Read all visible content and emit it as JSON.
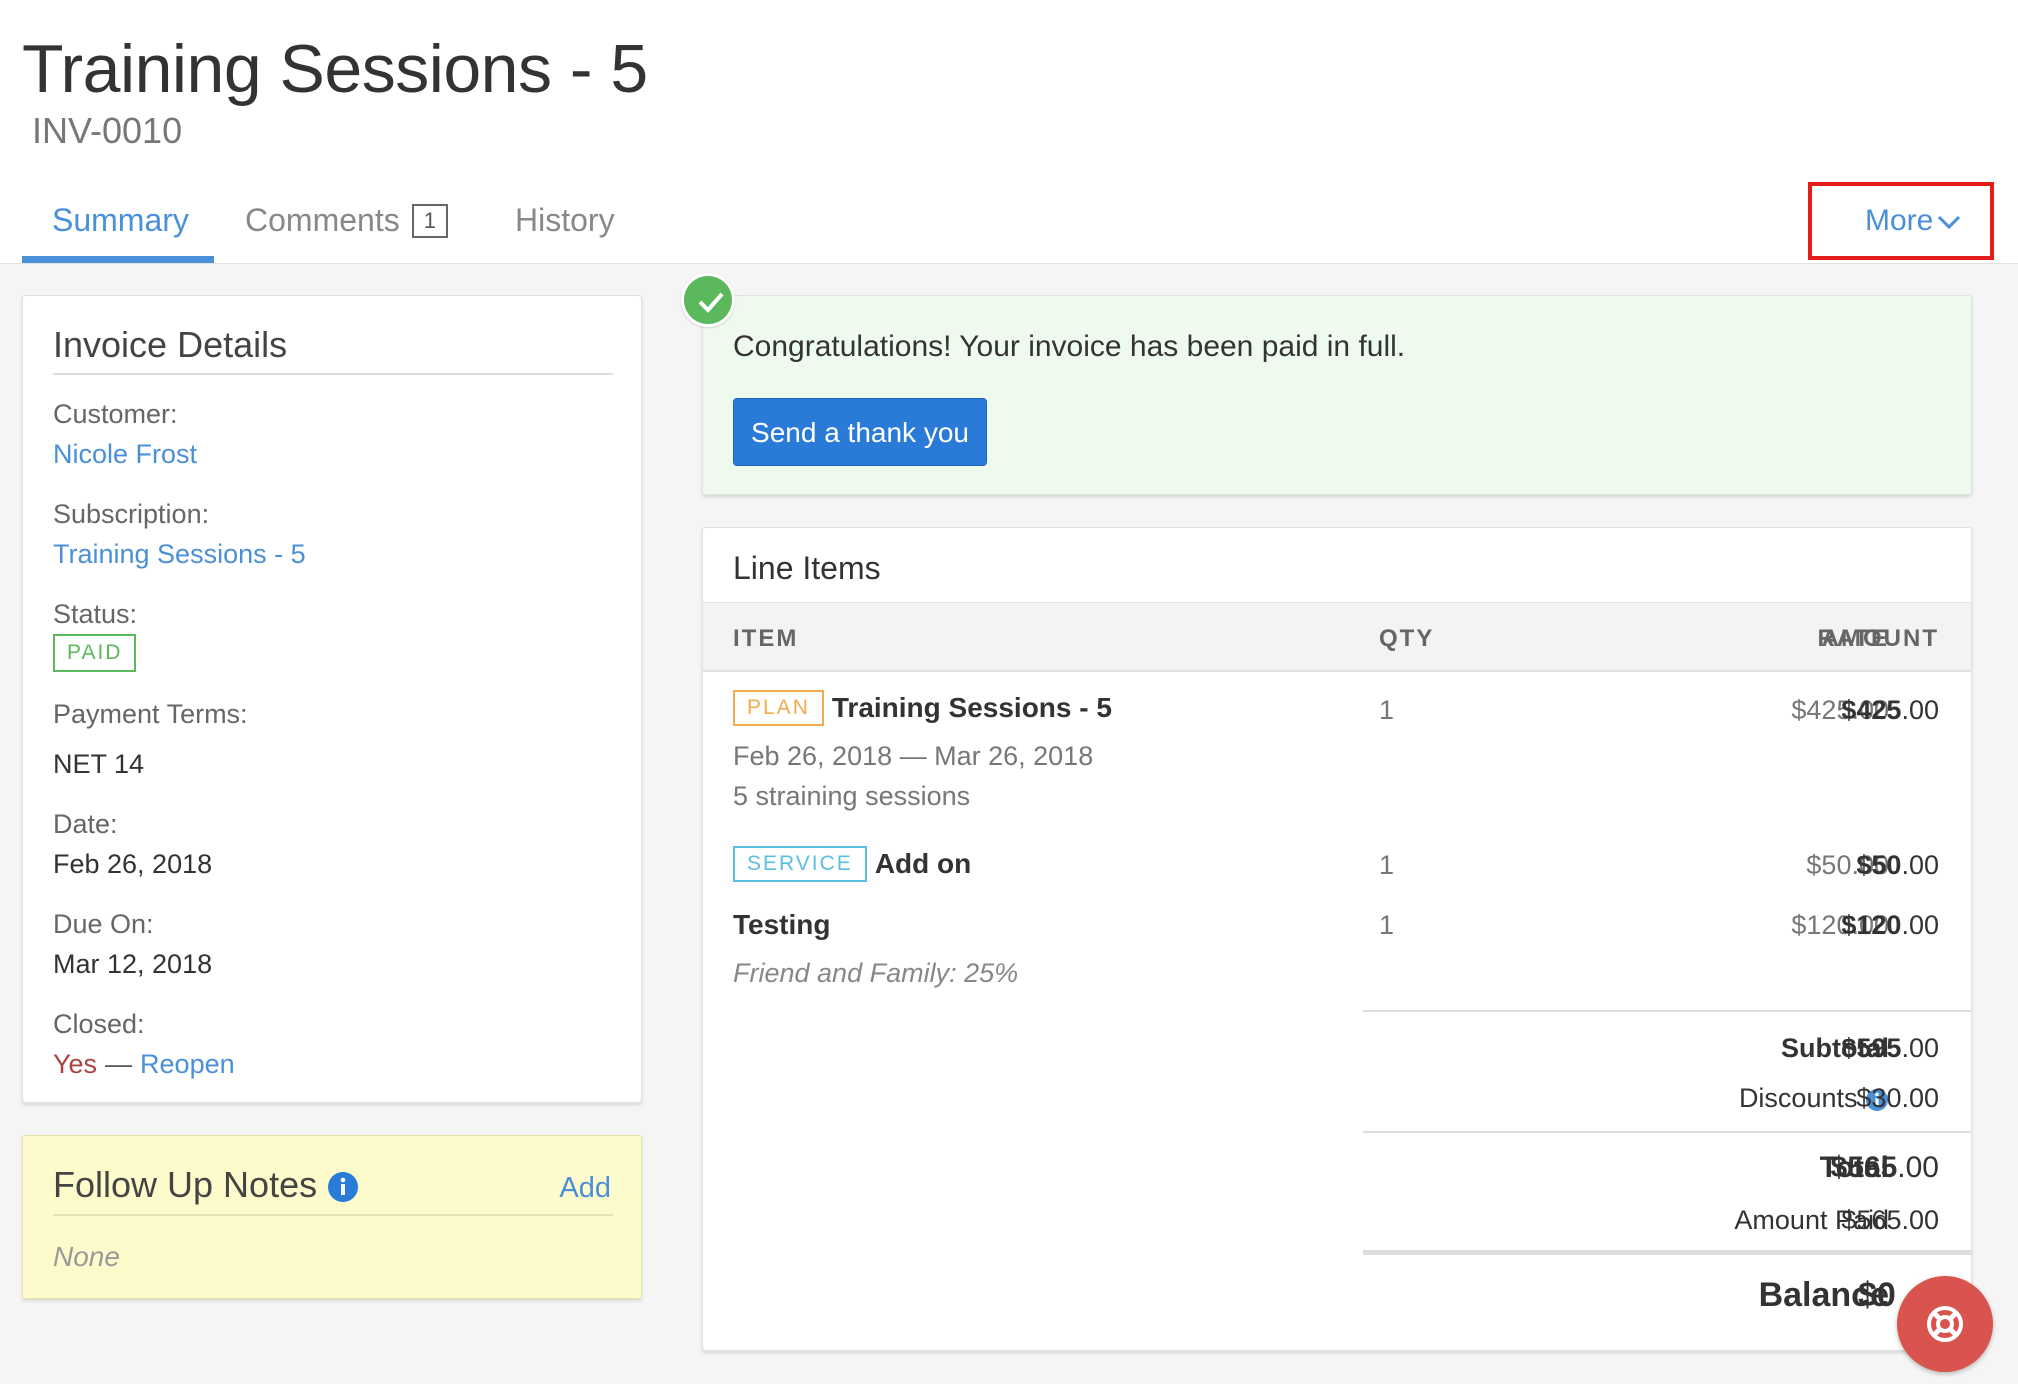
{
  "header": {
    "title": "Training Sessions - 5",
    "invoice_number": "INV-0010"
  },
  "tabs": [
    {
      "label": "Summary",
      "active": true
    },
    {
      "label": "Comments",
      "badge": "1"
    },
    {
      "label": "History"
    }
  ],
  "more_label": "More",
  "invoice_details": {
    "heading": "Invoice Details",
    "customer_label": "Customer:",
    "customer_value": "Nicole Frost",
    "subscription_label": "Subscription:",
    "subscription_value": "Training Sessions - 5",
    "status_label": "Status:",
    "status_value": "PAID",
    "payment_terms_label": "Payment Terms:",
    "payment_terms_value": "NET 14",
    "date_label": "Date:",
    "date_value": "Feb 26, 2018",
    "due_label": "Due On:",
    "due_value": "Mar 12, 2018",
    "closed_label": "Closed:",
    "closed_value": "Yes",
    "closed_separator": "—",
    "reopen_label": "Reopen"
  },
  "follow_up": {
    "title": "Follow Up Notes",
    "add_label": "Add",
    "empty_text": "None"
  },
  "success": {
    "message": "Congratulations! Your invoice has been paid in full.",
    "button_label": "Send a thank you"
  },
  "line_items": {
    "title": "Line Items",
    "columns": [
      "ITEM",
      "QTY",
      "RATE",
      "AMOUNT"
    ],
    "rows": [
      {
        "tag": "PLAN",
        "name": "Training Sessions - 5",
        "period": "Feb 26, 2018 — Mar 26, 2018",
        "description": "5 straining sessions",
        "qty": "1",
        "rate": "$425.00",
        "amount_whole": "$425",
        "amount_cents": ".00"
      },
      {
        "tag": "SERVICE",
        "name": "Add on",
        "qty": "1",
        "rate": "$50.00",
        "amount_whole": "$50",
        "amount_cents": ".00"
      },
      {
        "name": "Testing",
        "qty": "1",
        "rate": "$120.00",
        "amount_whole": "$120",
        "amount_cents": ".00"
      }
    ],
    "discount_note": "Friend and Family: 25%",
    "totals": {
      "subtotal_label": "Subtotal",
      "subtotal_whole": "$595",
      "subtotal_cents": ".00",
      "discounts_label": "Discounts",
      "discounts_value": "$30.00",
      "total_label": "Total",
      "total_whole": "$565",
      "total_cents": ".00",
      "amount_paid_label": "Amount Paid",
      "amount_paid_value": "$565.00",
      "balance_label": "Balance",
      "balance_value": "$0"
    }
  },
  "colors": {
    "accent": "#4a90d9",
    "success": "#5cb85c",
    "danger": "#d9534f",
    "highlight_box": "#e21b1b"
  }
}
